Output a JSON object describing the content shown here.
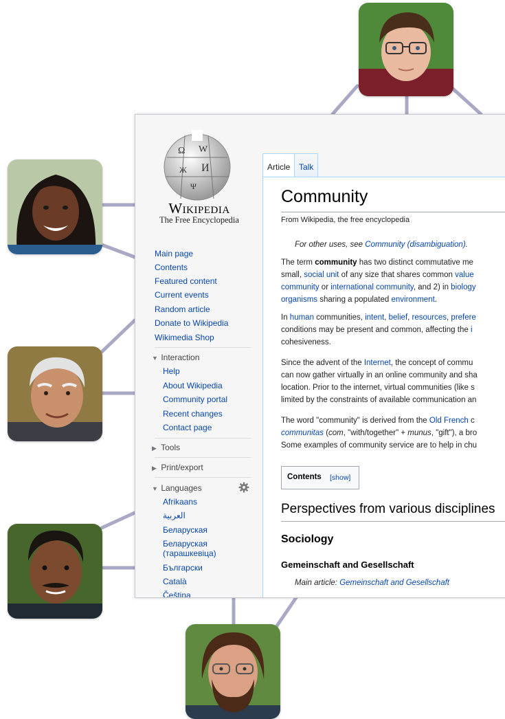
{
  "tabs": {
    "article": "Article",
    "talk": "Talk"
  },
  "logo": {
    "wordmark": "Wikipedia",
    "tagline": "The Free Encyclopedia"
  },
  "nav": {
    "main": [
      "Main page",
      "Contents",
      "Featured content",
      "Current events",
      "Random article",
      "Donate to Wikipedia",
      "Wikimedia Shop"
    ],
    "interaction": {
      "heading": "Interaction",
      "items": [
        "Help",
        "About Wikipedia",
        "Community portal",
        "Recent changes",
        "Contact page"
      ]
    },
    "tools": "Tools",
    "print_export": "Print/export",
    "languages": {
      "heading": "Languages",
      "items": [
        "Afrikaans",
        "العربية",
        "Беларуская",
        "Беларуская",
        "(тарашкевіца)",
        "Български",
        "Català",
        "Čeština"
      ]
    }
  },
  "article": {
    "title": "Community",
    "tagline": "From Wikipedia, the free encyclopedia",
    "hatnote": {
      "prefix": "For other uses, see ",
      "link": "Community (disambiguation)",
      "suffix": "."
    },
    "p1": [
      {
        "t": "The term ",
        "s": "n"
      },
      {
        "t": "community",
        "s": "b"
      },
      {
        "t": " has two distinct commutative me",
        "s": "n"
      }
    ],
    "p1b": [
      {
        "t": "small, ",
        "s": "n"
      },
      {
        "t": "social unit",
        "s": "l"
      },
      {
        "t": " of any size that shares common ",
        "s": "n"
      },
      {
        "t": "value",
        "s": "l"
      }
    ],
    "p1c": [
      {
        "t": "community",
        "s": "l"
      },
      {
        "t": " or ",
        "s": "n"
      },
      {
        "t": "international community",
        "s": "l"
      },
      {
        "t": ", and 2) in ",
        "s": "n"
      },
      {
        "t": "biology",
        "s": "l"
      }
    ],
    "p1d": [
      {
        "t": "organisms",
        "s": "l"
      },
      {
        "t": " sharing a populated ",
        "s": "n"
      },
      {
        "t": "environment",
        "s": "l"
      },
      {
        "t": ".",
        "s": "n"
      }
    ],
    "p2a": [
      {
        "t": "In ",
        "s": "n"
      },
      {
        "t": "human",
        "s": "l"
      },
      {
        "t": " communities, ",
        "s": "n"
      },
      {
        "t": "intent",
        "s": "l"
      },
      {
        "t": ", ",
        "s": "n"
      },
      {
        "t": "belief",
        "s": "l"
      },
      {
        "t": ", ",
        "s": "n"
      },
      {
        "t": "resources",
        "s": "l"
      },
      {
        "t": ", ",
        "s": "n"
      },
      {
        "t": "prefere",
        "s": "l"
      }
    ],
    "p2b": [
      {
        "t": "conditions may be present and common, affecting the ",
        "s": "n"
      },
      {
        "t": "i",
        "s": "l"
      }
    ],
    "p2c": [
      {
        "t": "cohesiveness.",
        "s": "n"
      }
    ],
    "p3a": [
      {
        "t": "Since the advent of the ",
        "s": "n"
      },
      {
        "t": "Internet",
        "s": "l"
      },
      {
        "t": ", the concept of commu",
        "s": "n"
      }
    ],
    "p3b": [
      {
        "t": "can now gather virtually in an online community and sha",
        "s": "n"
      }
    ],
    "p3c": [
      {
        "t": "location. Prior to the internet, virtual communities (like s",
        "s": "n"
      }
    ],
    "p3d": [
      {
        "t": "limited by the constraints of available communication an",
        "s": "n"
      }
    ],
    "p4a": [
      {
        "t": "The word \"community\" is derived from the ",
        "s": "n"
      },
      {
        "t": "Old French",
        "s": "l"
      },
      {
        "t": " c",
        "s": "n"
      }
    ],
    "p4b": [
      {
        "t": "communitas",
        "s": "li"
      },
      {
        "t": " (",
        "s": "n"
      },
      {
        "t": "com",
        "s": "i"
      },
      {
        "t": ", \"with/together\" + ",
        "s": "n"
      },
      {
        "t": "munus",
        "s": "i"
      },
      {
        "t": ", \"gift\"), a bro",
        "s": "n"
      }
    ],
    "p4c": [
      {
        "t": "Some examples of community service are to help in chu",
        "s": "n"
      }
    ],
    "toc": {
      "title": "Contents",
      "toggle": "[show]"
    },
    "h2": "Perspectives from various disciplines",
    "h3": "Sociology",
    "h4": "Gemeinschaft and Gesellschaft",
    "main_article": {
      "prefix": "Main article: ",
      "link": "Gemeinschaft and Gesellschaft"
    }
  },
  "colors": {
    "link": "#0645ad",
    "connector": "#a9a9c6",
    "sidebar_bg": "#f6f6f6"
  }
}
